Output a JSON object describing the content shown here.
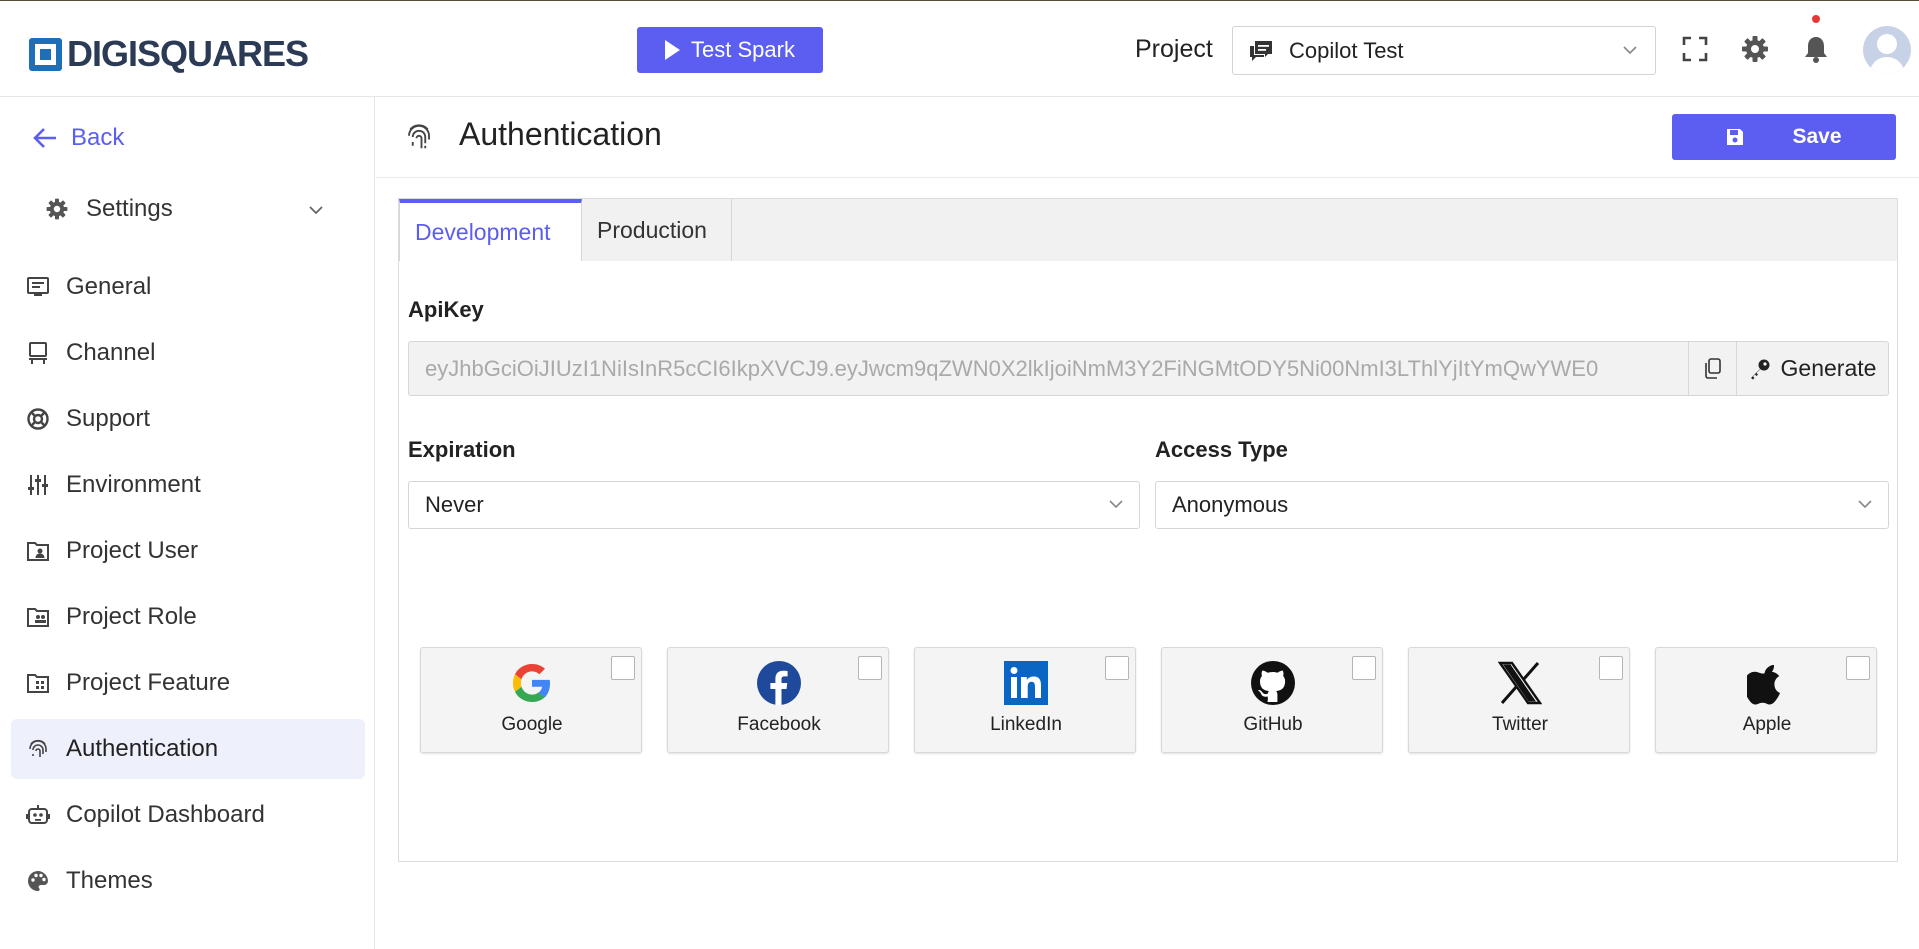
{
  "brand": {
    "name": "DIGISQUARES"
  },
  "header": {
    "test_spark_label": "Test Spark",
    "project_label": "Project",
    "project_selected": "Copilot Test"
  },
  "sidebar": {
    "back_label": "Back",
    "settings_label": "Settings",
    "items": [
      {
        "label": "General",
        "icon": "general-icon"
      },
      {
        "label": "Channel",
        "icon": "channel-icon"
      },
      {
        "label": "Support",
        "icon": "support-icon"
      },
      {
        "label": "Environment",
        "icon": "sliders-icon"
      },
      {
        "label": "Project User",
        "icon": "project-user-icon"
      },
      {
        "label": "Project Role",
        "icon": "project-role-icon"
      },
      {
        "label": "Project Feature",
        "icon": "project-feature-icon"
      },
      {
        "label": "Authentication",
        "icon": "fingerprint-icon",
        "active": true
      },
      {
        "label": "Copilot Dashboard",
        "icon": "robot-icon"
      },
      {
        "label": "Themes",
        "icon": "palette-icon"
      }
    ]
  },
  "page": {
    "title": "Authentication",
    "save_label": "Save"
  },
  "tabs": [
    {
      "label": "Development",
      "active": true
    },
    {
      "label": "Production",
      "active": false
    }
  ],
  "form": {
    "apikey_label": "ApiKey",
    "apikey_value": "eyJhbGciOiJIUzI1NiIsInR5cCI6IkpXVCJ9.eyJwcm9qZWN0X2lkIjoiNmM3Y2FiNGMtODY5Ni00NmI3LThlYjItYmQwYWE0",
    "generate_label": "Generate",
    "expiration_label": "Expiration",
    "expiration_value": "Never",
    "access_type_label": "Access Type",
    "access_type_value": "Anonymous"
  },
  "providers": [
    {
      "name": "Google",
      "icon": "google-icon",
      "checked": false
    },
    {
      "name": "Facebook",
      "icon": "facebook-icon",
      "checked": false
    },
    {
      "name": "LinkedIn",
      "icon": "linkedin-icon",
      "checked": false
    },
    {
      "name": "GitHub",
      "icon": "github-icon",
      "checked": false
    },
    {
      "name": "Twitter",
      "icon": "twitter-x-icon",
      "checked": false
    },
    {
      "name": "Apple",
      "icon": "apple-icon",
      "checked": false
    }
  ],
  "colors": {
    "accent": "#5b5ef0",
    "sidebar_active_bg": "#eef0fc",
    "notification_dot": "#e53935"
  }
}
